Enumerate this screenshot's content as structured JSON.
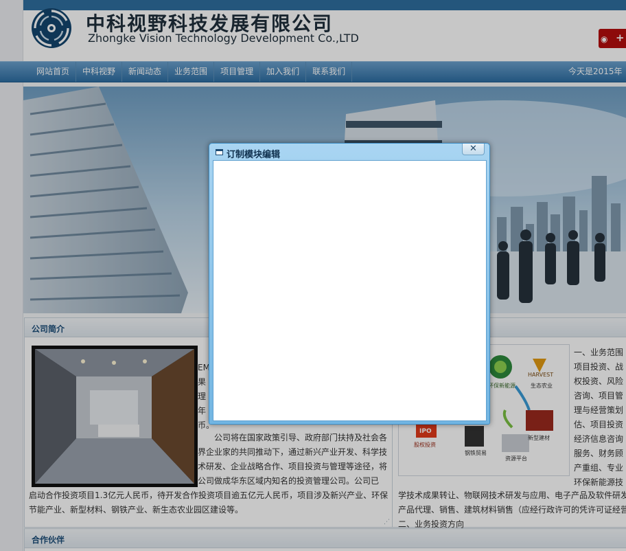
{
  "header": {
    "company_cn": "中科视野科技发展有限公司",
    "company_en": "Zhongke Vision Technology Development Co.,LTD"
  },
  "nav": {
    "items": [
      "网站首页",
      "中科视野",
      "新闻动态",
      "业务范围",
      "项目管理",
      "加入我们",
      "联系我们"
    ],
    "today": "今天是2015年"
  },
  "intro": {
    "title": "公司简介",
    "text1_chars": [
      "EM",
      "果",
      "理",
      "年",
      "币。"
    ],
    "text2": "公司将在国家政策引导、政府部门扶持及社会各界企业家的共同推动下，通过新兴产业开发、科学技术研发、企业战略合作、项目投资与管理等途径，将公司做成华东区域内知名的投资管理公司。公司已",
    "text3": "启动合作投资项目1.3亿元人民币，待开发合作投资项目逾五亿元人民币，项目涉及新兴产业、环保节能产业、新型材料、钢铁产业、新生态农业园区建设等。"
  },
  "business": {
    "diagram_labels": [
      "环保新能源",
      "HARVEST",
      "生态农业",
      "IPO",
      "股权投资",
      "钢铁贸易",
      "资源平台",
      "新型建材"
    ],
    "list": [
      "一、业务范围",
      "项目投资、战",
      "权投资、风险",
      "咨询、项目管",
      "理与经营策划",
      "估、项目投资",
      "经济信息咨询",
      "服务、财务顾",
      "产重组、专业",
      "环保新能源技"
    ],
    "para": [
      "学技术成果转让、物联网技术研发与应用、电子产品及软件研发",
      "产品代理、销售、建筑材料销售（应经行政许可的凭许可证经营",
      "二、业务投资方向"
    ]
  },
  "partners": {
    "title": "合作伙伴"
  },
  "dialog": {
    "title": "订制模块编辑",
    "close_glyph": "✕"
  },
  "colors": {
    "nav_blue": "#2e6ea3",
    "weibo_red": "#b50d0d",
    "dialog_blue": "#72b5e2"
  }
}
